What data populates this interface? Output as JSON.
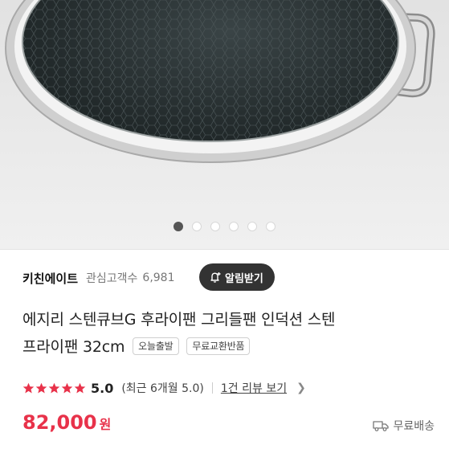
{
  "gallery": {
    "slide_count": 6,
    "active_index": 0
  },
  "store": {
    "name": "키친에이트",
    "favorites_label": "관심고객수",
    "favorites_count": "6,981",
    "alert_button_label": "알림받기"
  },
  "product": {
    "title_line1": "에지리 스텐큐브G 후라이팬 그리들팬 인덕션 스텐",
    "title_line2": "프라이팬 32cm",
    "tags": [
      "오늘출발",
      "무료교환반품"
    ]
  },
  "rating": {
    "stars": 5,
    "value": "5.0",
    "recent": "(최근 6개월 5.0)",
    "review_link": "1건 리뷰 보기"
  },
  "price": {
    "amount": "82,000",
    "currency": "원",
    "shipping": "무료배송"
  },
  "colors": {
    "price": "#e8324a",
    "star": "#e8324a",
    "alert_button_bg": "#333333"
  },
  "icons": [
    "bell-plus-icon",
    "star-icon",
    "chevron-right-icon",
    "truck-icon"
  ]
}
